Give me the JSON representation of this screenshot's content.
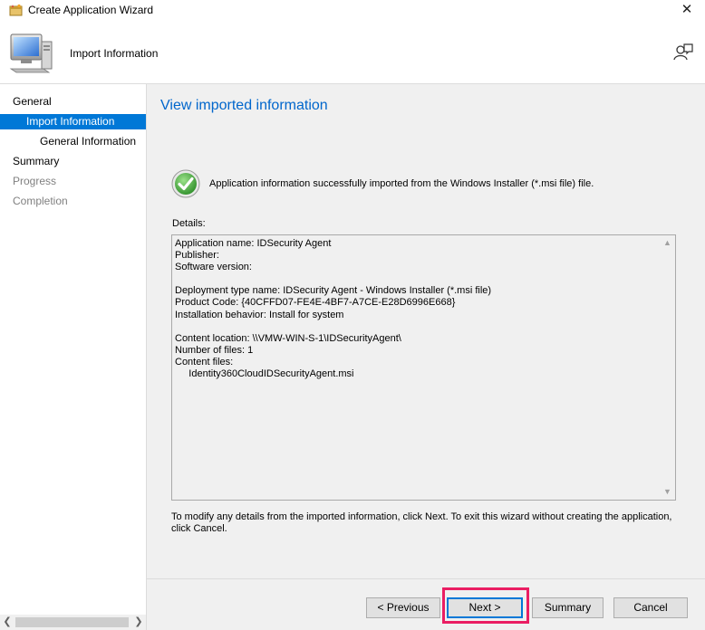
{
  "window": {
    "title": "Create Application Wizard",
    "close_glyph": "✕"
  },
  "header": {
    "title": "Import Information"
  },
  "nav": {
    "items": [
      {
        "label": "General"
      },
      {
        "label": "Import Information"
      },
      {
        "label": "General Information"
      },
      {
        "label": "Summary"
      },
      {
        "label": "Progress"
      },
      {
        "label": "Completion"
      }
    ]
  },
  "main": {
    "heading": "View imported information",
    "status_message": "Application information successfully imported from the Windows Installer (*.msi file) file.",
    "details_label": "Details:",
    "details_lines": [
      "Application name: IDSecurity Agent",
      "Publisher:",
      "Software version:",
      "",
      "Deployment type name: IDSecurity Agent - Windows Installer (*.msi file)",
      "Product Code: {40CFFD07-FE4E-4BF7-A7CE-E28D6996E668}",
      "Installation behavior: Install for system",
      "",
      "Content location: \\\\VMW-WIN-S-1\\IDSecurityAgent\\",
      "Number of files: 1",
      "Content files:",
      "     Identity360CloudIDSecurityAgent.msi"
    ],
    "footer_note": "To modify any details from the imported information, click Next. To exit this wizard without creating the application, click Cancel."
  },
  "buttons": {
    "previous": "< Previous",
    "next": "Next >",
    "summary": "Summary",
    "cancel": "Cancel"
  },
  "icons": {
    "app": "wizard-app-icon",
    "header": "computer-icon",
    "feedback": "feedback-icon",
    "status": "success-checkmark-icon"
  },
  "colors": {
    "accent": "#0078d7",
    "heading": "#0066cc",
    "success": "#3aa23a",
    "highlight": "#ea1e63"
  }
}
